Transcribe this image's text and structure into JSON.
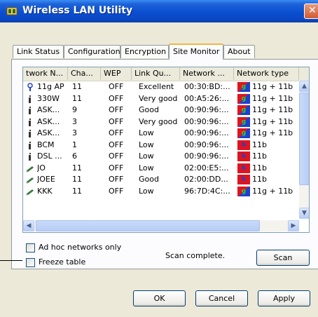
{
  "window": {
    "title": "Wireless LAN Utility"
  },
  "tabs": [
    {
      "label": "Link Status"
    },
    {
      "label": "Configuration"
    },
    {
      "label": "Encryption"
    },
    {
      "label": "Site Monitor"
    },
    {
      "label": "About"
    }
  ],
  "active_tab": "Site Monitor",
  "list": {
    "columns": [
      "twork N...",
      "Cha...",
      "WEP",
      "Link Qu...",
      "Network ...",
      "Network type"
    ],
    "rows": [
      {
        "name": "11g AP",
        "channel": "11",
        "wep": "OFF",
        "quality": "Excellent",
        "mac": "00:30:BD:...",
        "type": "11g + 11b",
        "icon": "ap-icon",
        "badge": "11g-badge"
      },
      {
        "name": "330W",
        "channel": "11",
        "wep": "OFF",
        "quality": "Very good",
        "mac": "00:A5:26:...",
        "type": "11g + 11b",
        "icon": "station-icon",
        "badge": "11g-badge"
      },
      {
        "name": "ASK...",
        "channel": "9",
        "wep": "OFF",
        "quality": "Good",
        "mac": "00:90:96:...",
        "type": "11g + 11b",
        "icon": "station-icon",
        "badge": "11g-badge"
      },
      {
        "name": "ASK...",
        "channel": "3",
        "wep": "OFF",
        "quality": "Very good",
        "mac": "00:90:96:...",
        "type": "11g + 11b",
        "icon": "station-icon",
        "badge": "11g-badge"
      },
      {
        "name": "ASK...",
        "channel": "3",
        "wep": "OFF",
        "quality": "Low",
        "mac": "00:90:96:...",
        "type": "11g + 11b",
        "icon": "station-icon",
        "badge": "11g-badge"
      },
      {
        "name": "BCM",
        "channel": "1",
        "wep": "OFF",
        "quality": "Low",
        "mac": "00:90:96:...",
        "type": "11b",
        "icon": "station-icon",
        "badge": "11b-badge"
      },
      {
        "name": "DSL ...",
        "channel": "6",
        "wep": "OFF",
        "quality": "Low",
        "mac": "00:90:96:...",
        "type": "11b",
        "icon": "station-icon",
        "badge": "11b-badge"
      },
      {
        "name": "JO",
        "channel": "11",
        "wep": "OFF",
        "quality": "Low",
        "mac": "02:00:E5:...",
        "type": "11b",
        "icon": "adhoc-icon",
        "badge": "11b-badge"
      },
      {
        "name": "JOEE",
        "channel": "11",
        "wep": "OFF",
        "quality": "Good",
        "mac": "02:00:DD...",
        "type": "11b",
        "icon": "adhoc-icon",
        "badge": "11b-badge"
      },
      {
        "name": "KKK",
        "channel": "11",
        "wep": "OFF",
        "quality": "Low",
        "mac": "96:7D:4C:...",
        "type": "11g + 11b",
        "icon": "adhoc-icon",
        "badge": "11g-badge"
      }
    ]
  },
  "options": {
    "adhoc_only": {
      "label": "Ad hoc networks only",
      "checked": false
    },
    "freeze_table": {
      "label": "Freeze table",
      "checked": false
    }
  },
  "status": {
    "text": "Scan complete."
  },
  "buttons": {
    "scan": "Scan",
    "ok": "OK",
    "cancel": "Cancel",
    "apply": "Apply"
  },
  "colors": {
    "title_bar": "#0a4fd0",
    "badge_red": "#e0141e",
    "badge_blue": "#1e3fd0",
    "badge_green": "#2a9a2a"
  }
}
